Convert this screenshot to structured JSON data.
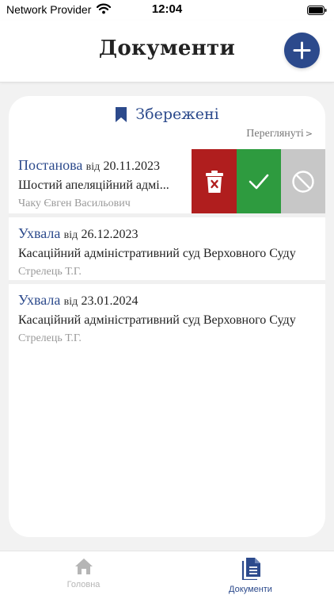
{
  "status_bar": {
    "carrier": "Network Provider",
    "time": "12:04"
  },
  "header": {
    "title": "Документи"
  },
  "saved": {
    "title": "Збережені",
    "viewed_link": "Переглянуті",
    "viewed_chevron": ">"
  },
  "documents": [
    {
      "type": "Постанова",
      "vid": "від",
      "date": "20.11.2023",
      "court": "Шостий апеляційний адмі...",
      "judge": "Чаку Євген Васильович"
    },
    {
      "type": "Ухвала",
      "vid": "від",
      "date": "26.12.2023",
      "court": "Касаційний адміністративний суд Верховного Суду",
      "judge": "Стрелець Т.Г."
    },
    {
      "type": "Ухвала",
      "vid": "від",
      "date": "23.01.2024",
      "court": "Касаційний адміністративний суд Верховного Суду",
      "judge": "Стрелець Т.Г."
    }
  ],
  "row_actions": {
    "delete_icon": "trash-icon",
    "confirm_icon": "check-icon",
    "cancel_icon": "block-icon",
    "delete_color": "#b01e1e",
    "confirm_color": "#2e9b3f",
    "cancel_color": "#c7c7c7"
  },
  "tab_bar": {
    "tabs": [
      {
        "label": "Головна",
        "icon": "home-icon",
        "active": false
      },
      {
        "label": "Документи",
        "icon": "document-icon",
        "active": true
      }
    ]
  },
  "colors": {
    "accent": "#2c4a8c",
    "background": "#f2f2f2"
  }
}
